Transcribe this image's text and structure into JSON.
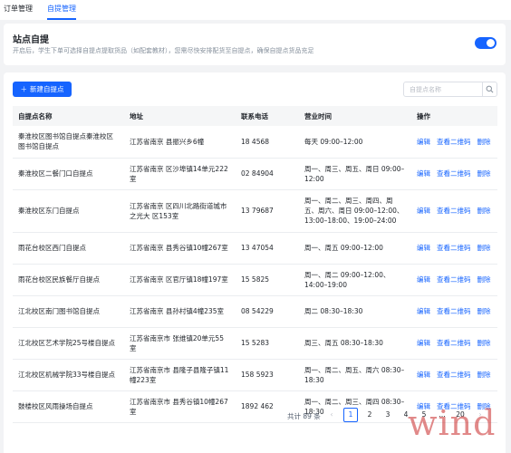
{
  "tabs": [
    {
      "label": "订单管理"
    },
    {
      "label": "自提管理"
    }
  ],
  "switch_card": {
    "title": "站点自提",
    "desc": "开启后，学生下单可选择自提点提取货品（如配套教材），您需尽快安排配货至自提点，确保自提点货品充足",
    "enabled": true,
    "accent": "#1664ff"
  },
  "toolbar": {
    "new_label": "新建自提点",
    "search_placeholder": "自提点名称"
  },
  "table": {
    "headers": [
      "自提点名称",
      "地址",
      "联系电话",
      "营业时间",
      "操作"
    ],
    "rows": [
      {
        "name": "秦淮校区图书馆自提点秦淮校区图书馆自提点",
        "addr": "江苏省南京         县振兴乡6幢",
        "phone": "18         4568",
        "hours": "每天 09:00–12:00"
      },
      {
        "name": "秦淮校区二餐门口自提点",
        "addr": "江苏省南京         区沙埠镇14单元222室",
        "phone": "02         84904",
        "hours": "周一、周三、周五、周日 09:00–12:00"
      },
      {
        "name": "秦淮校区东门自提点",
        "addr": "江苏省南京         区四川北路街道城市之光大         区153室",
        "phone": "13         79687",
        "hours": "周一、周二、周三、周四、周五、周六、周日 09:00–12:00、13:00–18:00、19:00–24:00"
      },
      {
        "name": "雨花台校区西门自提点",
        "addr": "江苏省南京         县秀谷镇10幢267室",
        "phone": "13         47054",
        "hours": "周一、周五 09:00–12:00"
      },
      {
        "name": "雨花台校区民族餐厅自提点",
        "addr": "江苏省南京         区官厅镇18幢197室",
        "phone": "15         5825",
        "hours": "周一、周二 09:00–12:00、14:00–19:00"
      },
      {
        "name": "江北校区南门图书馆自提点",
        "addr": "江苏省南京         县孙村镇4幢235室",
        "phone": "08         54229",
        "hours": "周二 08:30–18:30"
      },
      {
        "name": "江北校区艺术学院25号楼自提点",
        "addr": "江苏省南京市         张维镇20单元55室",
        "phone": "15         5283",
        "hours": "周三、周五 08:30–18:30"
      },
      {
        "name": "江北校区机械学院33号楼自提点",
        "addr": "江苏省南京市         县隆子县隆子镇11幢223室",
        "phone": "158         5923",
        "hours": "周一、周二、周五、周六 08:30–18:30"
      },
      {
        "name": "鼓楼校区风雨操场自提点",
        "addr": "江苏省南京市         县秀谷镇10幢267室",
        "phone": "1892         462",
        "hours": "周一、周二、周三、周四 08:30–18:30"
      }
    ],
    "ops": {
      "edit": "编辑",
      "qrcode": "查看二维码",
      "delete": "删除"
    }
  },
  "pagination": {
    "total": "共计 89 条",
    "prev": "‹",
    "pages": [
      "1",
      "2",
      "3",
      "4",
      "5",
      "…",
      "20"
    ],
    "next": "›",
    "current": "1"
  },
  "watermark": "wind"
}
